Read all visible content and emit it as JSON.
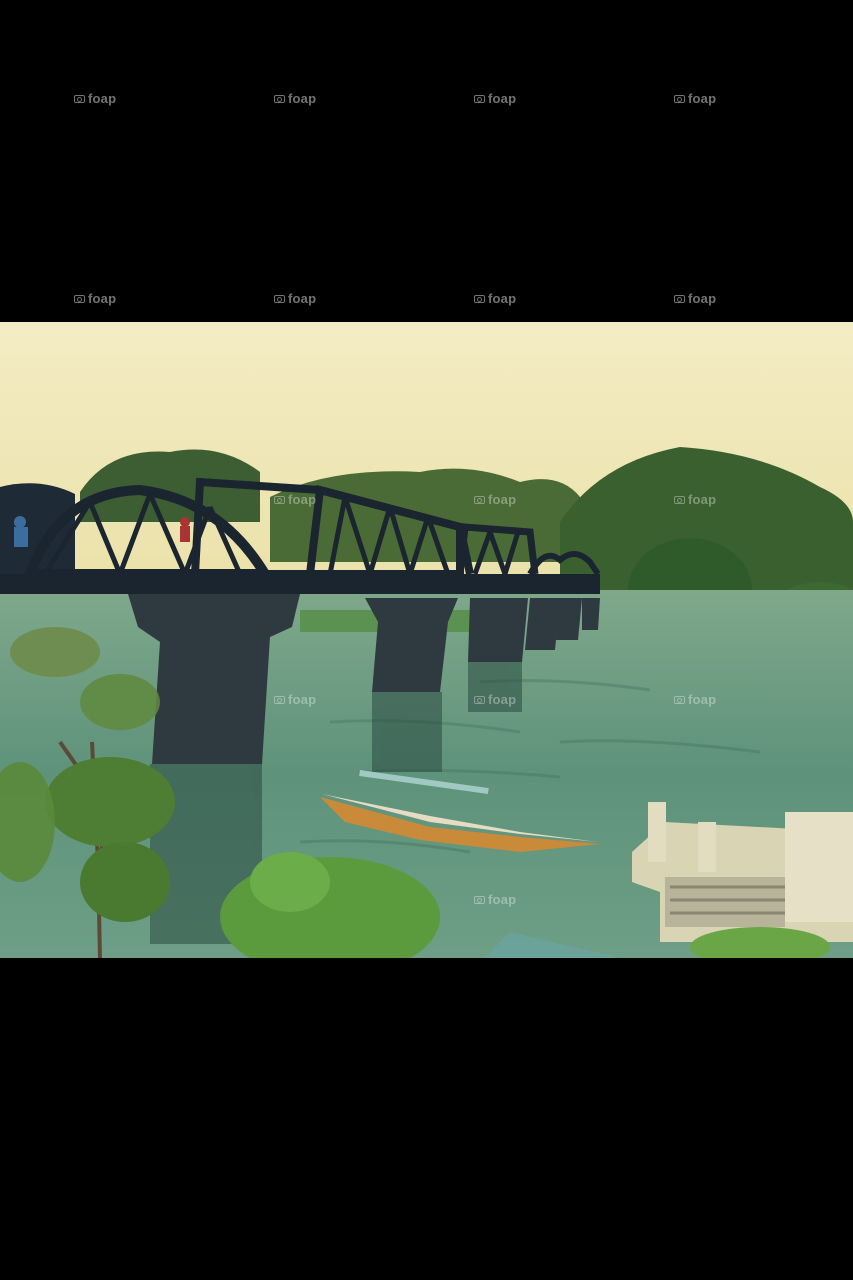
{
  "watermark": {
    "text": "foap",
    "icon": "camera-icon"
  },
  "photo": {
    "subject": "bridge-over-river",
    "colors": {
      "sky": "#f3e9b8",
      "water": "#5b8f74",
      "bridge": "#1b2530",
      "foliage": "#3f6b2e"
    }
  }
}
